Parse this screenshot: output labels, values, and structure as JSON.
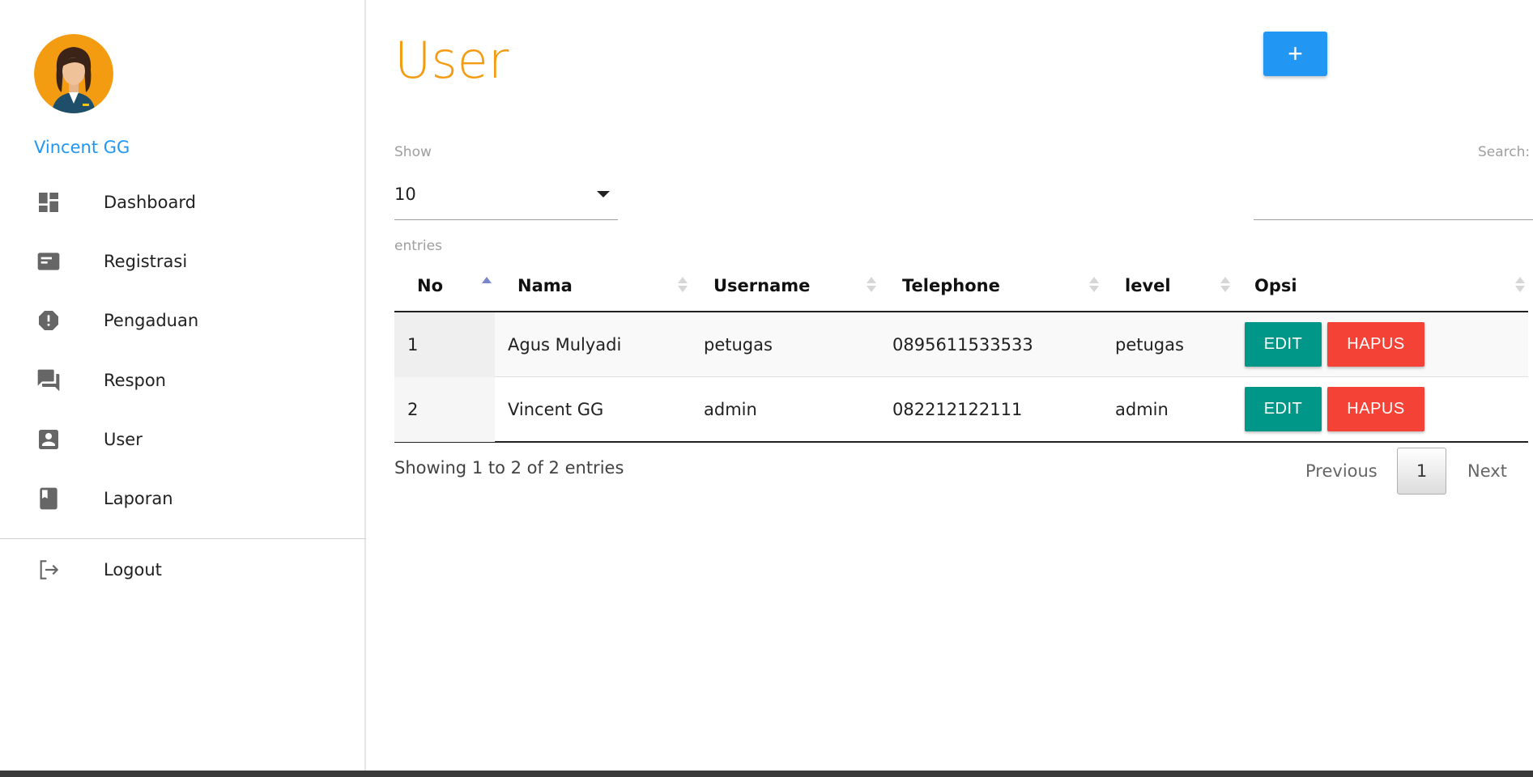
{
  "user": {
    "name": "Vincent GG"
  },
  "sidebar": {
    "items": [
      {
        "label": "Dashboard",
        "icon": "dashboard-icon"
      },
      {
        "label": "Registrasi",
        "icon": "card-icon"
      },
      {
        "label": "Pengaduan",
        "icon": "alert-icon"
      },
      {
        "label": "Respon",
        "icon": "forum-icon"
      },
      {
        "label": "User",
        "icon": "account-box-icon"
      },
      {
        "label": "Laporan",
        "icon": "book-icon"
      }
    ],
    "logout": {
      "label": "Logout",
      "icon": "logout-icon"
    }
  },
  "page": {
    "title": "User",
    "add_label": "+"
  },
  "length": {
    "show_label": "Show",
    "value": "10",
    "entries_label": "entries"
  },
  "search": {
    "label": "Search:",
    "value": ""
  },
  "table": {
    "columns": [
      "No",
      "Nama",
      "Username",
      "Telephone",
      "level",
      "Opsi"
    ],
    "rows": [
      {
        "no": "1",
        "nama": "Agus Mulyadi",
        "username": "petugas",
        "telephone": "0895611533533",
        "level": "petugas",
        "edit": "EDIT",
        "hapus": "HAPUS"
      },
      {
        "no": "2",
        "nama": "Vincent GG",
        "username": "admin",
        "telephone": "082212122111",
        "level": "admin",
        "edit": "EDIT",
        "hapus": "HAPUS"
      }
    ]
  },
  "footer": {
    "info": "Showing 1 to 2 of 2 entries",
    "previous": "Previous",
    "current_page": "1",
    "next": "Next"
  },
  "colors": {
    "title": "#f39c12",
    "accent": "#2196f3",
    "edit": "#009688",
    "hapus": "#f44336"
  }
}
